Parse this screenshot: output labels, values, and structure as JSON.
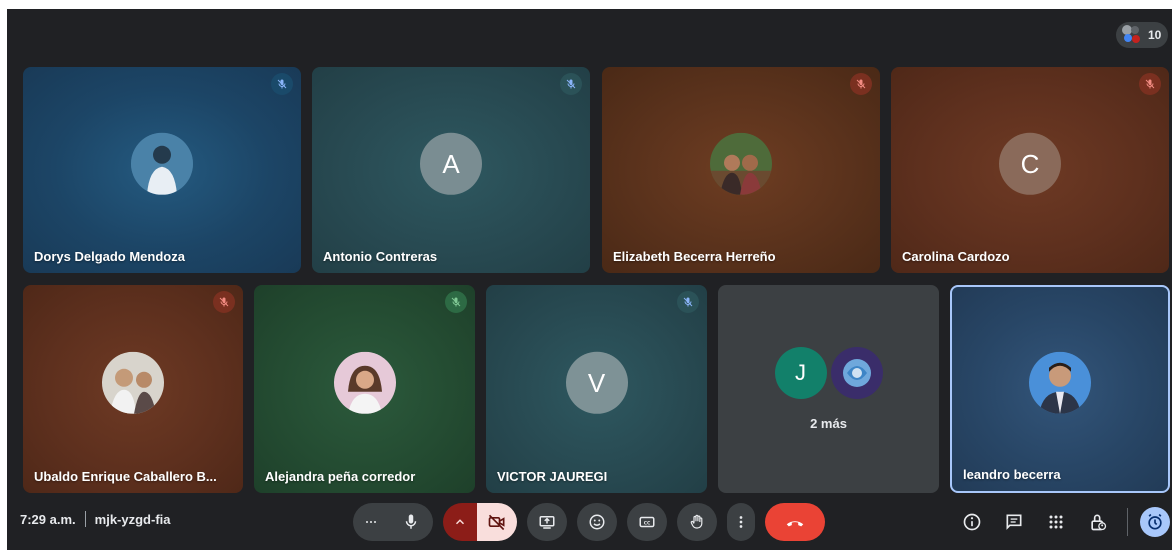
{
  "top_bar": {
    "participants_count": "10"
  },
  "participants": [
    {
      "name": "Dorys Delgado Mendoza",
      "avatar_type": "photo",
      "muted": true
    },
    {
      "name": "Antonio Contreras",
      "avatar_type": "letter",
      "initial": "A",
      "muted": true
    },
    {
      "name": "Elizabeth Becerra Herreño",
      "avatar_type": "photo",
      "muted": true
    },
    {
      "name": "Carolina Cardozo",
      "avatar_type": "letter",
      "initial": "C",
      "muted": true
    },
    {
      "name": "Ubaldo Enrique Caballero B...",
      "avatar_type": "photo",
      "muted": true
    },
    {
      "name": "Alejandra peña corredor",
      "avatar_type": "photo",
      "muted": true
    },
    {
      "name": "VICTOR JAUREGI",
      "avatar_type": "letter",
      "initial": "V",
      "muted": true
    },
    {
      "name": "leandro becerra",
      "avatar_type": "photo",
      "muted": false,
      "is_self": true
    }
  ],
  "overflow_tile": {
    "initial": "J",
    "label": "2 más"
  },
  "bottom_bar": {
    "time": "7:29 a.m.",
    "meeting_code": "mjk-yzgd-fia"
  },
  "colors": {
    "background": "#202124",
    "control_bg": "#3c4043",
    "end_call": "#ea4335",
    "camera_off": "#f9dedc",
    "self_border": "#a8c7fa"
  },
  "icons": [
    "more-horiz-icon",
    "mic-icon",
    "chevron-up-icon",
    "camera-off-icon",
    "present-icon",
    "emoji-icon",
    "captions-icon",
    "raise-hand-icon",
    "more-vert-icon",
    "end-call-icon",
    "info-icon",
    "chat-icon",
    "activities-icon",
    "host-controls-icon",
    "timer-icon"
  ]
}
